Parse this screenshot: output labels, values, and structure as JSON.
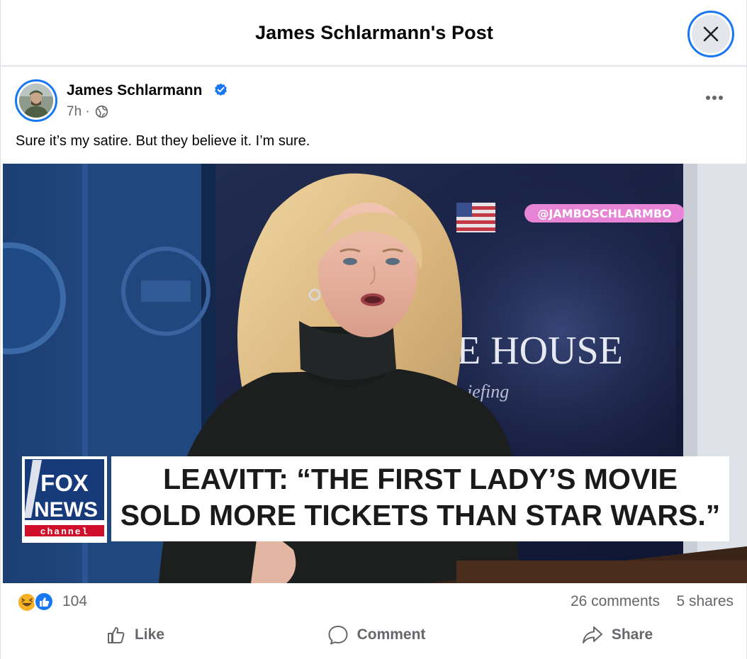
{
  "header": {
    "title": "James Schlarmann's Post",
    "close_label": "Close"
  },
  "post": {
    "author_name": "James Schlarmann",
    "verified": true,
    "time": "7h ·",
    "audience_icon": "globe-icon",
    "text": "Sure it’s my satire. But they believe it. I’m sure.",
    "image": {
      "watermark": "@JAMBOSCHLARMBO",
      "backdrop_text": "E HOUSE",
      "backdrop_subtext": "iefing",
      "network_logo_line1": "FOX",
      "network_logo_line2": "NEWS",
      "network_logo_line3": "channel",
      "headline_line1": "LEAVITT: “THE FIRST LADY’S MOVIE",
      "headline_line2": "SOLD MORE TICKETS THAN STAR WARS.”"
    }
  },
  "stats": {
    "reactions": [
      "haha-icon",
      "like-icon"
    ],
    "reaction_count": "104",
    "comments": "26 comments",
    "shares": "5 shares"
  },
  "actions": {
    "like": "Like",
    "comment": "Comment",
    "share": "Share"
  },
  "colors": {
    "accent": "#1877f2",
    "secondary_text": "#65676b",
    "divider": "#e4e6eb",
    "haha": "#f7b125"
  }
}
